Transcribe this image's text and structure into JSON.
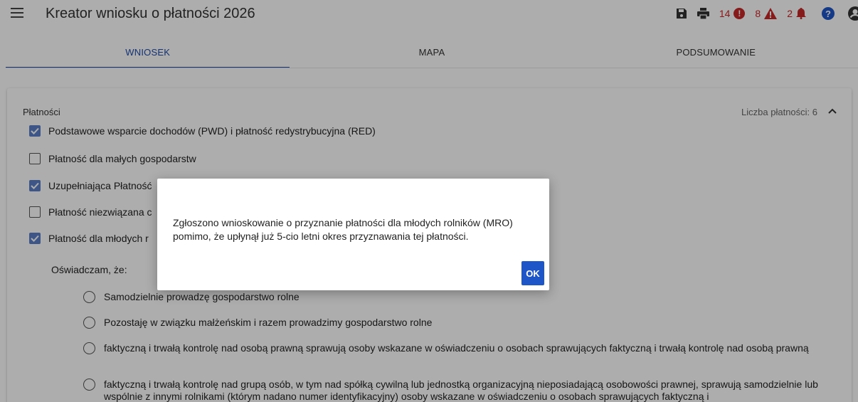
{
  "app": {
    "title": "Kreator wniosku o płatności 2026"
  },
  "toolbar": {
    "icons": [
      "save-icon",
      "print-icon",
      "error-icon",
      "warning-icon",
      "bell-icon",
      "help-icon",
      "account-icon"
    ],
    "error_count": "14",
    "warning_count": "8",
    "notification_count": "2",
    "colors": {
      "error": "#c62828",
      "accent": "#1e56c8"
    }
  },
  "tabs": [
    {
      "label": "WNIOSEK",
      "active": true
    },
    {
      "label": "MAPA",
      "active": false
    },
    {
      "label": "PODSUMOWANIE",
      "active": false
    }
  ],
  "payments": {
    "section_title": "Płatności",
    "count_label": "Liczba płatności: 6",
    "items": [
      {
        "label": "Podstawowe wsparcie dochodów (PWD) i płatność redystrybucyjna (RED)",
        "checked": true
      },
      {
        "label": "Płatność dla małych gospodarstw",
        "checked": false
      },
      {
        "label": "Uzupełniająca Płatność",
        "checked": true
      },
      {
        "label": "Płatność niezwiązana c",
        "checked": false
      },
      {
        "label": "Płatność dla młodych r",
        "checked": true
      }
    ]
  },
  "declaration": {
    "label": "Oświadczam, że:",
    "options": [
      "Samodzielnie prowadzę gospodarstwo rolne",
      "Pozostaję w związku małżeńskim i razem prowadzimy gospodarstwo rolne",
      "faktyczną i trwałą kontrolę nad osobą prawną sprawują osoby wskazane w oświadczeniu o osobach sprawujących faktyczną i trwałą kontrolę nad osobą prawną",
      "faktyczną i trwałą kontrolę nad grupą osób, w tym nad spółką cywilną lub jednostką organizacyjną nieposiadającą osobowości prawnej, sprawują samodzielnie lub wspólnie z innymi rolnikami (którym nadano numer identyfikacyjny) osoby wskazane w oświadczeniu o osobach sprawujących faktyczną i"
    ]
  },
  "dialog": {
    "message": "Zgłoszono wnioskowanie o przyznanie płatności dla młodych rolników (MRO) pomimo, że upłynął już 5-cio letni okres przyznawania tej płatności.",
    "ok_label": "OK"
  }
}
